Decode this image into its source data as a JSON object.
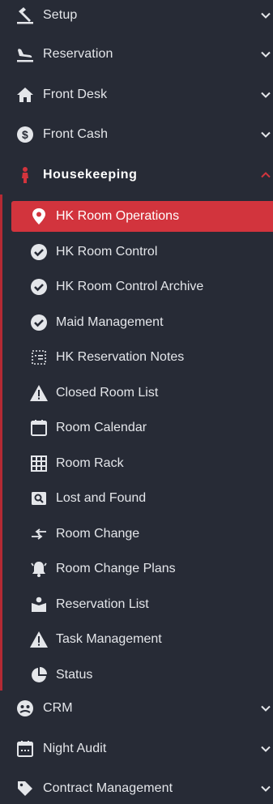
{
  "menu": [
    {
      "label": "Setup",
      "icon": "hammer-icon"
    },
    {
      "label": "Reservation",
      "icon": "plane-landing-icon"
    },
    {
      "label": "Front Desk",
      "icon": "home-icon"
    },
    {
      "label": "Front Cash",
      "icon": "dollar-circle-icon"
    },
    {
      "label": "Housekeeping",
      "icon": "maid-icon",
      "expanded": true
    },
    {
      "label": "CRM",
      "icon": "crm-icon"
    },
    {
      "label": "Night Audit",
      "icon": "calendar-dots-icon"
    },
    {
      "label": "Contract Management",
      "icon": "tag-icon"
    }
  ],
  "housekeeping_items": [
    {
      "label": "HK Room Operations",
      "icon": "map-marker-icon",
      "selected": true
    },
    {
      "label": "HK Room Control",
      "icon": "check-circle-icon"
    },
    {
      "label": "HK Room Control Archive",
      "icon": "check-circle-icon"
    },
    {
      "label": "Maid Management",
      "icon": "check-circle-icon"
    },
    {
      "label": "HK Reservation Notes",
      "icon": "notes-icon"
    },
    {
      "label": "Closed Room List",
      "icon": "warning-icon"
    },
    {
      "label": "Room Calendar",
      "icon": "calendar-icon"
    },
    {
      "label": "Room Rack",
      "icon": "grid-icon"
    },
    {
      "label": "Lost and Found",
      "icon": "search-box-icon"
    },
    {
      "label": "Room Change",
      "icon": "swap-arrows-icon"
    },
    {
      "label": "Room Change Plans",
      "icon": "bell-alert-icon"
    },
    {
      "label": "Reservation List",
      "icon": "person-box-icon"
    },
    {
      "label": "Task Management",
      "icon": "warning-icon"
    },
    {
      "label": "Status",
      "icon": "pie-chart-icon"
    }
  ],
  "colors": {
    "background": "#272b36",
    "accent": "#d2343d",
    "text": "#e4e6ea"
  }
}
